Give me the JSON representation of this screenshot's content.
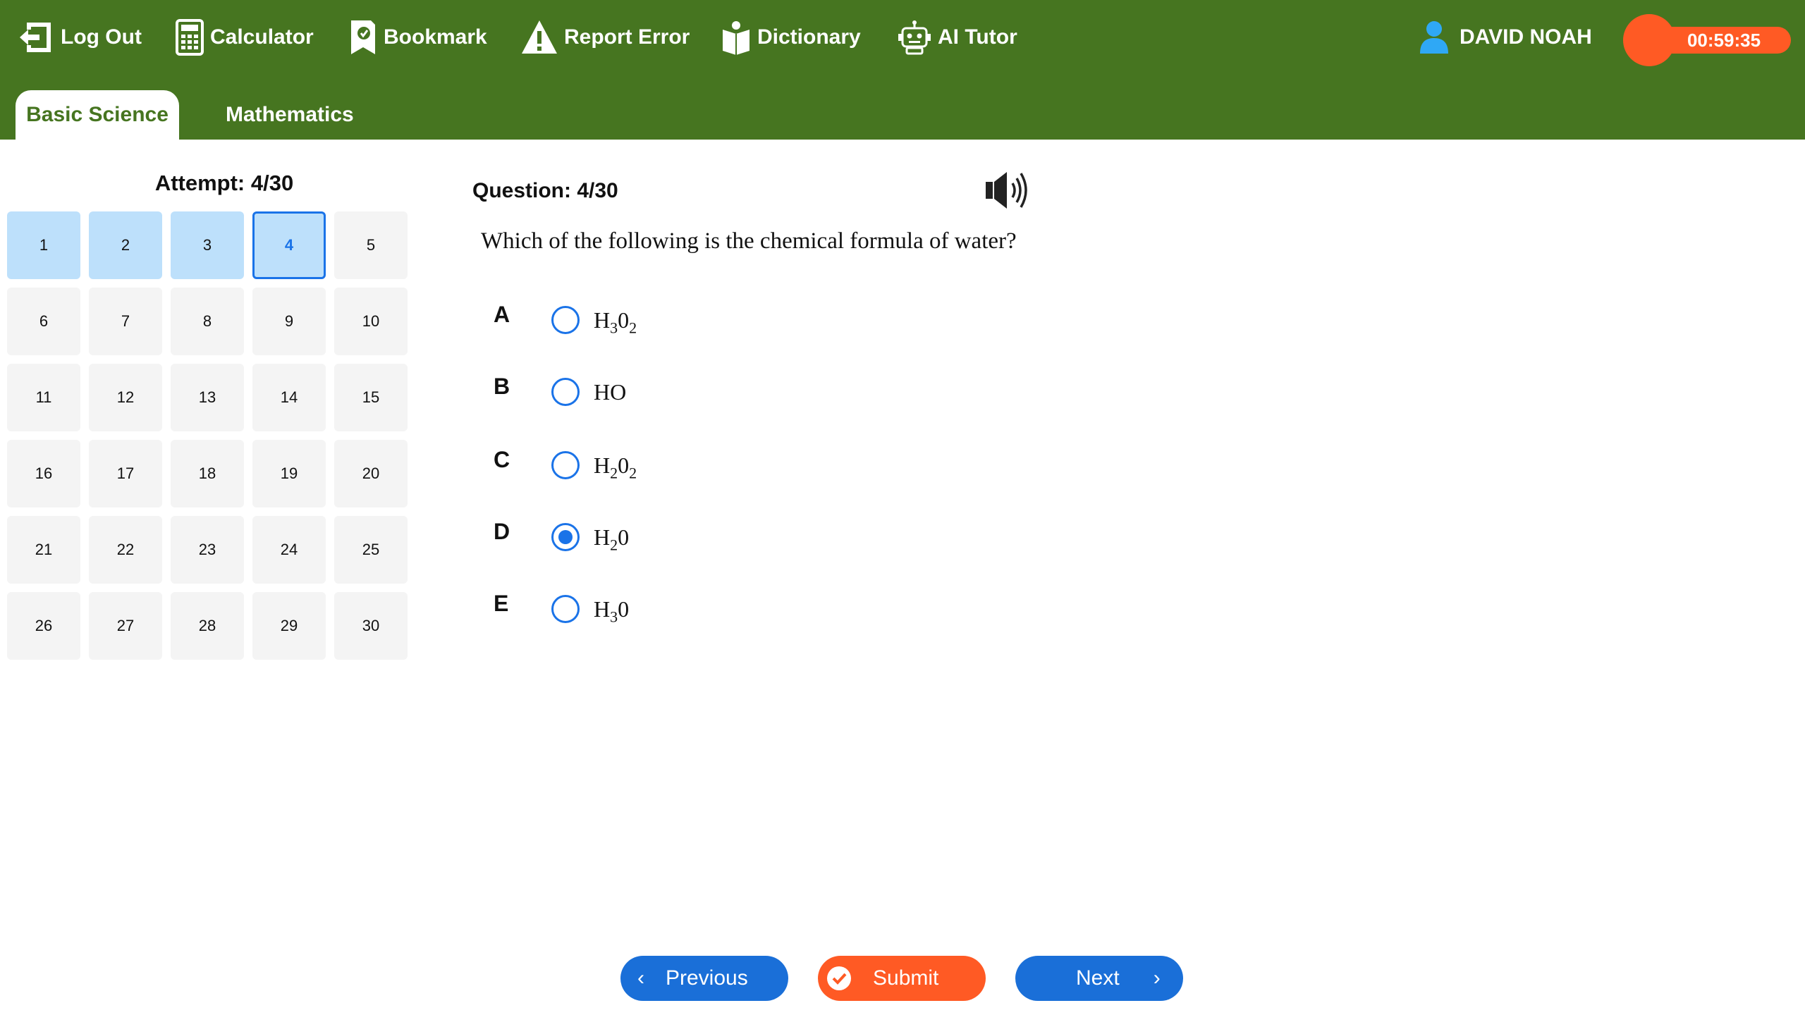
{
  "toolbar": {
    "logout": "Log Out",
    "calculator": "Calculator",
    "bookmark": "Bookmark",
    "report_error": "Report Error",
    "dictionary": "Dictionary",
    "ai_tutor": "AI Tutor"
  },
  "user": {
    "name": "DAVID NOAH"
  },
  "timer": {
    "value": "00:59:35"
  },
  "tabs": [
    {
      "label": "Basic Science",
      "active": true
    },
    {
      "label": "Mathematics",
      "active": false
    }
  ],
  "attempt": {
    "label": "Attempt: 4/30"
  },
  "question_grid": {
    "numbers": [
      "1",
      "2",
      "3",
      "4",
      "5",
      "6",
      "7",
      "8",
      "9",
      "10",
      "11",
      "12",
      "13",
      "14",
      "15",
      "16",
      "17",
      "18",
      "19",
      "20",
      "21",
      "22",
      "23",
      "24",
      "25",
      "26",
      "27",
      "28",
      "29",
      "30"
    ],
    "answered": [
      "1",
      "2",
      "3"
    ],
    "current": "4"
  },
  "question": {
    "number_label": "Question: 4/30",
    "text": "Which of the following is the chemical formula of water?",
    "options": [
      {
        "letter": "A",
        "base": "H",
        "sub1": "3",
        "mid": "0",
        "sub2": "2",
        "selected": false
      },
      {
        "letter": "B",
        "base": "HO",
        "sub1": "",
        "mid": "",
        "sub2": "",
        "selected": false
      },
      {
        "letter": "C",
        "base": "H",
        "sub1": "2",
        "mid": "0",
        "sub2": "2",
        "selected": false
      },
      {
        "letter": "D",
        "base": "H",
        "sub1": "2",
        "mid": "0",
        "sub2": "",
        "selected": true
      },
      {
        "letter": "E",
        "base": "H",
        "sub1": "3",
        "mid": "0",
        "sub2": "",
        "selected": false
      }
    ]
  },
  "footer": {
    "previous": "Previous",
    "submit": "Submit",
    "next": "Next"
  },
  "colors": {
    "header_bg": "#467520",
    "accent_blue": "#1a73e8",
    "timer_orange": "#ff5a24",
    "answered_bg": "#bde0fb"
  },
  "icons": [
    "logout-icon",
    "calculator-icon",
    "bookmark-icon",
    "warning-icon",
    "dictionary-icon",
    "robot-icon",
    "user-icon",
    "speaker-icon",
    "check-circle-icon",
    "chevron-left-icon",
    "chevron-right-icon"
  ]
}
